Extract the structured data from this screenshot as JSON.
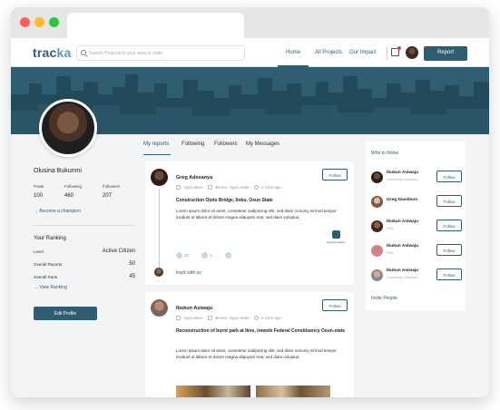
{
  "brand": {
    "logo_part1": "trac",
    "logo_part2": "ka"
  },
  "search": {
    "placeholder": "Search Projects in your area or state"
  },
  "nav": {
    "home": "Home",
    "all_projects": "All Projects",
    "our_impact": "Our Impact",
    "report": "Report"
  },
  "colors": {
    "primary": "#2f5d72",
    "banner": "#2f5d72",
    "skyline": "#234a5b"
  },
  "profile": {
    "name": "Olusina Bukunmi",
    "posts_label": "Posts",
    "posts": "100",
    "following_label": "Following",
    "following": "460",
    "followers_label": "Followers",
    "followers": "207",
    "champion": "Become a champion",
    "ranking_title": "Your Ranking",
    "level_label": "Level",
    "level": "Active Citizen",
    "reports_label": "Overall Reports",
    "reports": "50",
    "rank_label": "Overall Rank",
    "rank": "45",
    "view_ranking": "View Ranking",
    "edit": "Edit Profile"
  },
  "tabs": [
    "My reports",
    "Following",
    "Followers",
    "My Messages"
  ],
  "feed": [
    {
      "author": "Greg Adesanya",
      "follow": "Follow",
      "category": "Agriculture",
      "location": "Ikenne, Ogun-state",
      "time": "3 mins ago",
      "title": "Construction Ojotu Bridge, Ilobu, Osun State",
      "body": "Lorem ipsum dolor sit amet, consetetur sadipscing elitr, sed diam nonumy eirmod tempor invidunt ut labore et dolore magna aliquyam erat, sed diam voluptua",
      "reaction1": "20",
      "reaction2": "1",
      "approval": "Approval status",
      "track": "track with us"
    },
    {
      "author": "Ibukun Asiwaju",
      "follow": "Follow",
      "category": "Agriculture",
      "location": "Ikenne, Ogun-state",
      "time": "3 mins ago",
      "title": "Reconstruction of burnt park at Ikire, Irewole Federal Constituency Osun-state",
      "body": "Lorem ipsum dolor sit amet, consetetur sadipscing elitr, sed diam nonumy eirmod tempor invidunt ut labore et dolore magna aliquyam erat, sed diam voluptua"
    }
  ],
  "who_to_follow": {
    "title": "Who to follow",
    "people": [
      {
        "name": "Ibukun Asiwaju",
        "sub": "Community Champion",
        "follow": "Follow"
      },
      {
        "name": "Greg Davidson",
        "sub": "",
        "follow": "Follow"
      },
      {
        "name": "Ibukun Asiwaju",
        "sub": "FMA",
        "follow": "Follow"
      },
      {
        "name": "Ibukun Asiwaju",
        "sub": "FMA",
        "follow": "Follow"
      },
      {
        "name": "Ibukun Asiwaju",
        "sub": "Community Champion",
        "follow": "Follow"
      }
    ],
    "invite": "Invite People"
  }
}
